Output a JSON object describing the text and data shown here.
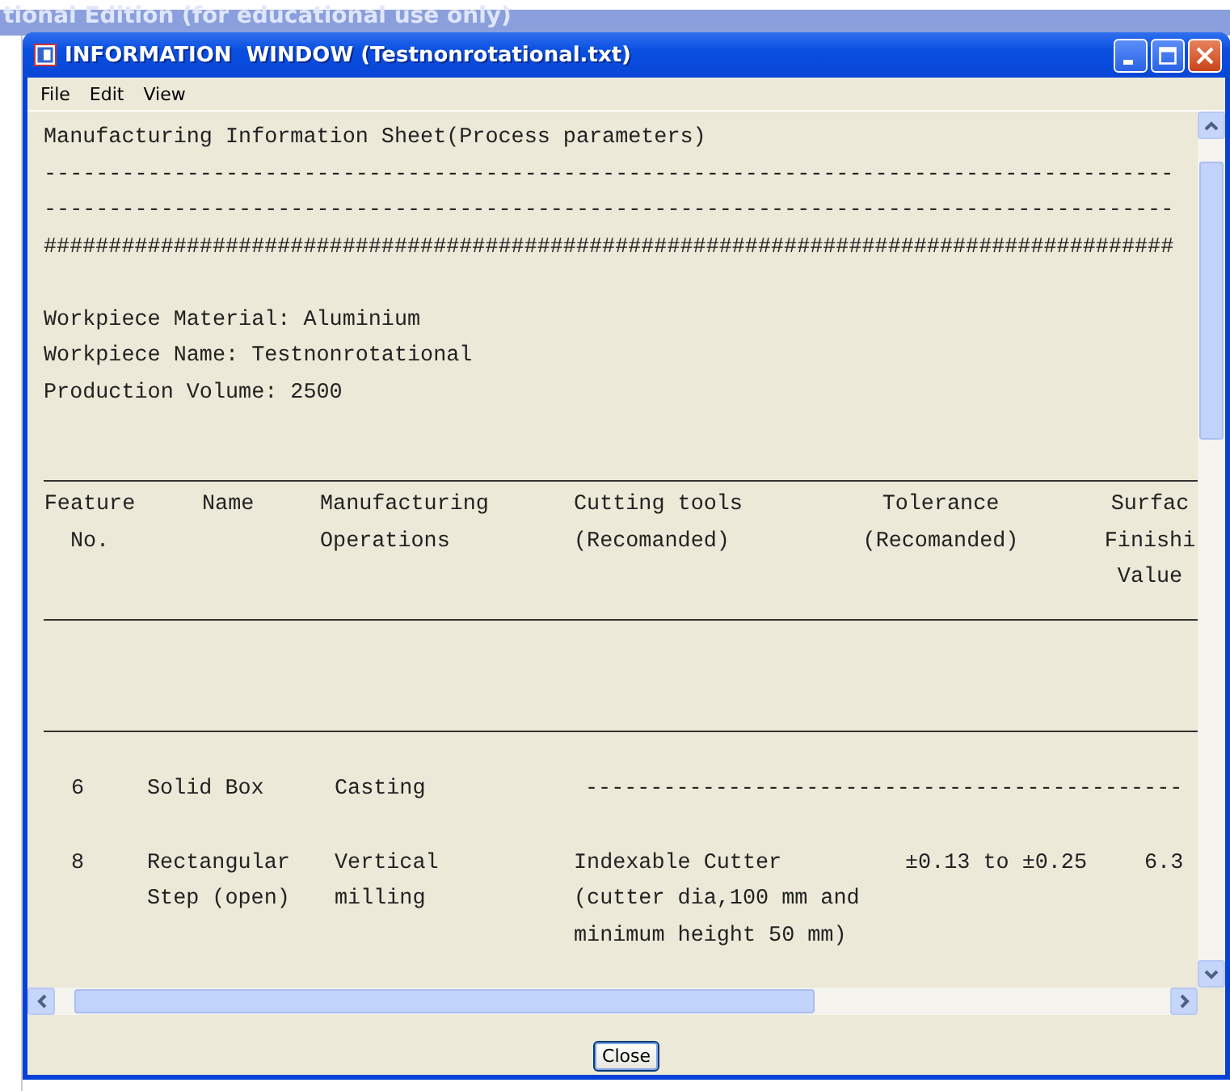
{
  "background_window": {
    "title": "tional Edition (for educational use only)"
  },
  "window": {
    "title": "INFORMATION  WINDOW (Testnonrotational.txt)"
  },
  "menu": [
    "File",
    "Edit",
    "View"
  ],
  "document": {
    "heading": "Manufacturing Information Sheet(Process parameters)",
    "separators": [
      "---------------------------------------------------------------------------------------",
      "---------------------------------------------------------------------------------------",
      "#######################################################################################"
    ],
    "fields": [
      "Workpiece Material: Aluminium",
      "Workpiece Name: Testnonrotational",
      "Production Volume: 2500"
    ]
  },
  "table": {
    "columns": [
      {
        "label": "Feature",
        "more_lines": [
          "No."
        ]
      },
      {
        "label": "Name"
      },
      {
        "label": "Manufacturing",
        "more_lines": [
          "Operations"
        ]
      },
      {
        "label": "Cutting tools",
        "more_lines": [
          "(Recomanded)"
        ]
      },
      {
        "label": "Tolerance",
        "more_lines": [
          "(Recomanded)"
        ]
      },
      {
        "label": "Surfac",
        "more_lines": [
          "Finishi",
          "Value"
        ]
      }
    ],
    "rows": [
      {
        "cells": [
          {
            "lines": [
              "6"
            ]
          },
          {
            "lines": [
              "Solid Box"
            ]
          },
          {
            "lines": [
              "Casting"
            ]
          },
          {
            "lines": [
              "----------------------------------------------"
            ]
          }
        ]
      },
      {
        "cells": [
          {
            "lines": [
              "8"
            ]
          },
          {
            "lines": [
              "Rectangular",
              "Step (open)"
            ]
          },
          {
            "lines": [
              "Vertical",
              "milling"
            ]
          },
          {
            "lines": [
              "Indexable Cutter",
              "(cutter dia,100 mm and",
              "minimum height 50 mm)"
            ]
          },
          {
            "lines": [
              "±0.13 to ±0.25"
            ]
          },
          {
            "lines": [
              "6.3"
            ]
          }
        ]
      }
    ]
  },
  "buttons": [
    "Close"
  ]
}
